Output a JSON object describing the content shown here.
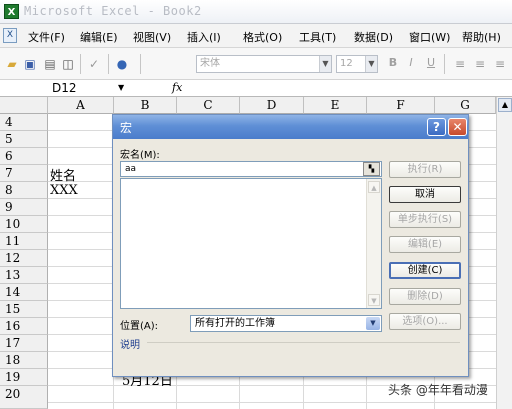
{
  "window": {
    "title": "Microsoft Excel - Book2",
    "app_icon": "excel-icon"
  },
  "menubar": {
    "items": [
      "文件(F)",
      "编辑(E)",
      "视图(V)",
      "插入(I)",
      "格式(O)",
      "工具(T)",
      "数据(D)",
      "窗口(W)",
      "帮助(H)"
    ]
  },
  "toolbar": {
    "font_name": "宋体",
    "font_size": "12",
    "bold": "B",
    "italic": "I",
    "underline": "U"
  },
  "formula_bar": {
    "cell_ref": "D12",
    "fx": "fx"
  },
  "grid": {
    "columns": [
      "A",
      "B",
      "C",
      "D",
      "E",
      "F",
      "G"
    ],
    "rows": [
      "4",
      "5",
      "6",
      "7",
      "8",
      "9",
      "10",
      "11",
      "12",
      "13",
      "14",
      "15",
      "16",
      "17",
      "18",
      "19",
      "20"
    ],
    "cells": {
      "a7": "姓名",
      "a8": "XXX",
      "b19": "5月12日"
    }
  },
  "dialog": {
    "title": "宏",
    "macro_name_label": "宏名(M):",
    "macro_name_value": "aa",
    "buttons": {
      "run": "执行(R)",
      "cancel": "取消",
      "step_into": "单步执行(S)",
      "edit": "编辑(E)",
      "create": "创建(C)",
      "delete": "删除(D)",
      "options": "选项(O)..."
    },
    "location_label": "位置(A):",
    "location_value": "所有打开的工作簿",
    "description_label": "说明"
  },
  "watermark": "头条 @年年看动漫",
  "colors": {
    "dialog_bg": "#ece9e0",
    "titlebar_blue": "#4a7ccb",
    "close_red": "#c74a2c",
    "link_blue": "#1f3f8f"
  }
}
